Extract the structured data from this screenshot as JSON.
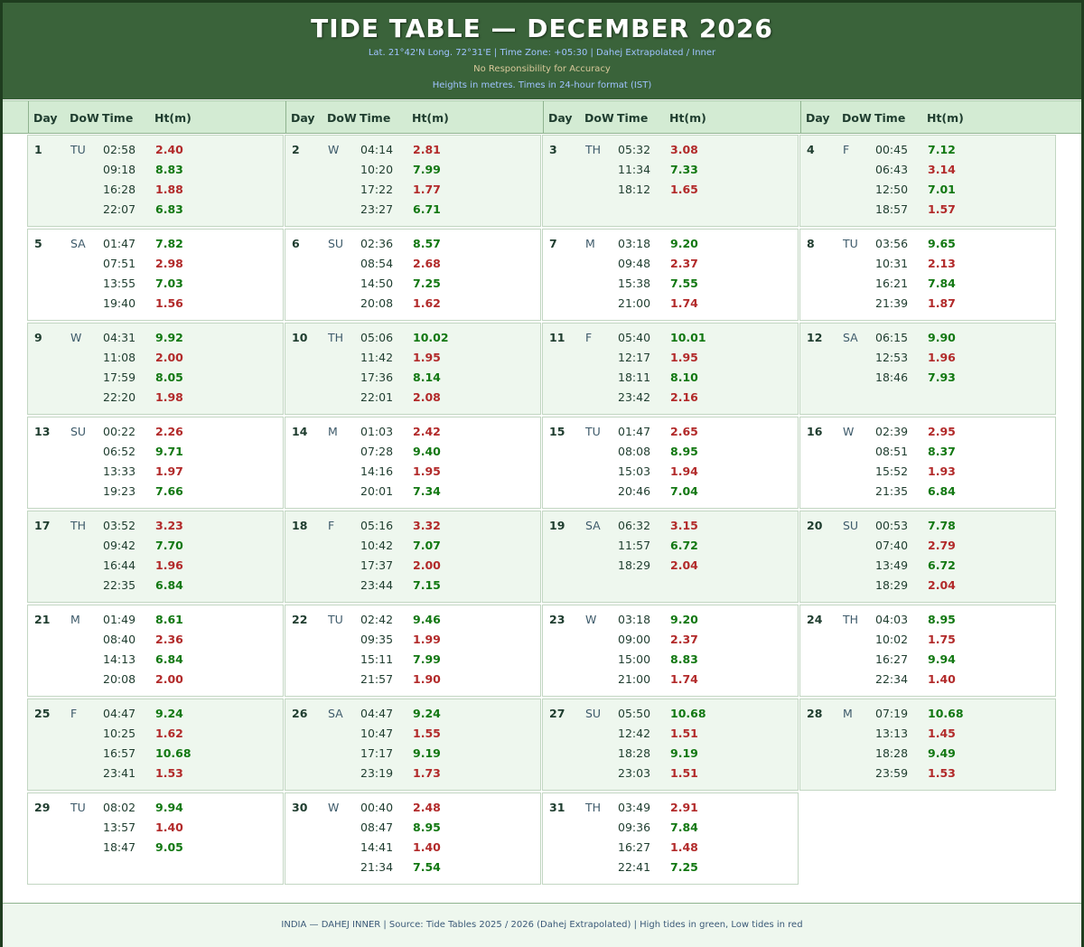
{
  "header": {
    "title": "TIDE TABLE — DECEMBER 2026",
    "line1": "Lat. 21°42'N  Long. 72°31'E   |   Time Zone: +05:30   |   Dahej Extrapolated / Inner",
    "line2": "No Responsibility for Accuracy",
    "line3": "Heights in metres.  Times in 24-hour format (IST)"
  },
  "columns": {
    "day": "Day",
    "dow": "DoW",
    "time": "Time",
    "height": "Ht(m)"
  },
  "days": [
    {
      "day": "1",
      "dow": "TU",
      "tides": [
        {
          "t": "02:58",
          "h": "2.40",
          "type": "low"
        },
        {
          "t": "09:18",
          "h": "8.83",
          "type": "high"
        },
        {
          "t": "16:28",
          "h": "1.88",
          "type": "low"
        },
        {
          "t": "22:07",
          "h": "6.83",
          "type": "high"
        }
      ]
    },
    {
      "day": "2",
      "dow": "W",
      "tides": [
        {
          "t": "04:14",
          "h": "2.81",
          "type": "low"
        },
        {
          "t": "10:20",
          "h": "7.99",
          "type": "high"
        },
        {
          "t": "17:22",
          "h": "1.77",
          "type": "low"
        },
        {
          "t": "23:27",
          "h": "6.71",
          "type": "high"
        }
      ]
    },
    {
      "day": "3",
      "dow": "TH",
      "tides": [
        {
          "t": "05:32",
          "h": "3.08",
          "type": "low"
        },
        {
          "t": "11:34",
          "h": "7.33",
          "type": "high"
        },
        {
          "t": "18:12",
          "h": "1.65",
          "type": "low"
        }
      ]
    },
    {
      "day": "4",
      "dow": "F",
      "tides": [
        {
          "t": "00:45",
          "h": "7.12",
          "type": "high"
        },
        {
          "t": "06:43",
          "h": "3.14",
          "type": "low"
        },
        {
          "t": "12:50",
          "h": "7.01",
          "type": "high"
        },
        {
          "t": "18:57",
          "h": "1.57",
          "type": "low"
        }
      ]
    },
    {
      "day": "5",
      "dow": "SA",
      "tides": [
        {
          "t": "01:47",
          "h": "7.82",
          "type": "high"
        },
        {
          "t": "07:51",
          "h": "2.98",
          "type": "low"
        },
        {
          "t": "13:55",
          "h": "7.03",
          "type": "high"
        },
        {
          "t": "19:40",
          "h": "1.56",
          "type": "low"
        }
      ]
    },
    {
      "day": "6",
      "dow": "SU",
      "tides": [
        {
          "t": "02:36",
          "h": "8.57",
          "type": "high"
        },
        {
          "t": "08:54",
          "h": "2.68",
          "type": "low"
        },
        {
          "t": "14:50",
          "h": "7.25",
          "type": "high"
        },
        {
          "t": "20:08",
          "h": "1.62",
          "type": "low"
        }
      ]
    },
    {
      "day": "7",
      "dow": "M",
      "tides": [
        {
          "t": "03:18",
          "h": "9.20",
          "type": "high"
        },
        {
          "t": "09:48",
          "h": "2.37",
          "type": "low"
        },
        {
          "t": "15:38",
          "h": "7.55",
          "type": "high"
        },
        {
          "t": "21:00",
          "h": "1.74",
          "type": "low"
        }
      ]
    },
    {
      "day": "8",
      "dow": "TU",
      "tides": [
        {
          "t": "03:56",
          "h": "9.65",
          "type": "high"
        },
        {
          "t": "10:31",
          "h": "2.13",
          "type": "low"
        },
        {
          "t": "16:21",
          "h": "7.84",
          "type": "high"
        },
        {
          "t": "21:39",
          "h": "1.87",
          "type": "low"
        }
      ]
    },
    {
      "day": "9",
      "dow": "W",
      "tides": [
        {
          "t": "04:31",
          "h": "9.92",
          "type": "high"
        },
        {
          "t": "11:08",
          "h": "2.00",
          "type": "low"
        },
        {
          "t": "17:59",
          "h": "8.05",
          "type": "high"
        },
        {
          "t": "22:20",
          "h": "1.98",
          "type": "low"
        }
      ]
    },
    {
      "day": "10",
      "dow": "TH",
      "tides": [
        {
          "t": "05:06",
          "h": "10.02",
          "type": "high"
        },
        {
          "t": "11:42",
          "h": "1.95",
          "type": "low"
        },
        {
          "t": "17:36",
          "h": "8.14",
          "type": "high"
        },
        {
          "t": "22:01",
          "h": "2.08",
          "type": "low"
        }
      ]
    },
    {
      "day": "11",
      "dow": "F",
      "tides": [
        {
          "t": "05:40",
          "h": "10.01",
          "type": "high"
        },
        {
          "t": "12:17",
          "h": "1.95",
          "type": "low"
        },
        {
          "t": "18:11",
          "h": "8.10",
          "type": "high"
        },
        {
          "t": "23:42",
          "h": "2.16",
          "type": "low"
        }
      ]
    },
    {
      "day": "12",
      "dow": "SA",
      "tides": [
        {
          "t": "06:15",
          "h": "9.90",
          "type": "high"
        },
        {
          "t": "12:53",
          "h": "1.96",
          "type": "low"
        },
        {
          "t": "18:46",
          "h": "7.93",
          "type": "high"
        }
      ]
    },
    {
      "day": "13",
      "dow": "SU",
      "tides": [
        {
          "t": "00:22",
          "h": "2.26",
          "type": "low"
        },
        {
          "t": "06:52",
          "h": "9.71",
          "type": "high"
        },
        {
          "t": "13:33",
          "h": "1.97",
          "type": "low"
        },
        {
          "t": "19:23",
          "h": "7.66",
          "type": "high"
        }
      ]
    },
    {
      "day": "14",
      "dow": "M",
      "tides": [
        {
          "t": "01:03",
          "h": "2.42",
          "type": "low"
        },
        {
          "t": "07:28",
          "h": "9.40",
          "type": "high"
        },
        {
          "t": "14:16",
          "h": "1.95",
          "type": "low"
        },
        {
          "t": "20:01",
          "h": "7.34",
          "type": "high"
        }
      ]
    },
    {
      "day": "15",
      "dow": "TU",
      "tides": [
        {
          "t": "01:47",
          "h": "2.65",
          "type": "low"
        },
        {
          "t": "08:08",
          "h": "8.95",
          "type": "high"
        },
        {
          "t": "15:03",
          "h": "1.94",
          "type": "low"
        },
        {
          "t": "20:46",
          "h": "7.04",
          "type": "high"
        }
      ]
    },
    {
      "day": "16",
      "dow": "W",
      "tides": [
        {
          "t": "02:39",
          "h": "2.95",
          "type": "low"
        },
        {
          "t": "08:51",
          "h": "8.37",
          "type": "high"
        },
        {
          "t": "15:52",
          "h": "1.93",
          "type": "low"
        },
        {
          "t": "21:35",
          "h": "6.84",
          "type": "high"
        }
      ]
    },
    {
      "day": "17",
      "dow": "TH",
      "tides": [
        {
          "t": "03:52",
          "h": "3.23",
          "type": "low"
        },
        {
          "t": "09:42",
          "h": "7.70",
          "type": "high"
        },
        {
          "t": "16:44",
          "h": "1.96",
          "type": "low"
        },
        {
          "t": "22:35",
          "h": "6.84",
          "type": "high"
        }
      ]
    },
    {
      "day": "18",
      "dow": "F",
      "tides": [
        {
          "t": "05:16",
          "h": "3.32",
          "type": "low"
        },
        {
          "t": "10:42",
          "h": "7.07",
          "type": "high"
        },
        {
          "t": "17:37",
          "h": "2.00",
          "type": "low"
        },
        {
          "t": "23:44",
          "h": "7.15",
          "type": "high"
        }
      ]
    },
    {
      "day": "19",
      "dow": "SA",
      "tides": [
        {
          "t": "06:32",
          "h": "3.15",
          "type": "low"
        },
        {
          "t": "11:57",
          "h": "6.72",
          "type": "high"
        },
        {
          "t": "18:29",
          "h": "2.04",
          "type": "low"
        }
      ]
    },
    {
      "day": "20",
      "dow": "SU",
      "tides": [
        {
          "t": "00:53",
          "h": "7.78",
          "type": "high"
        },
        {
          "t": "07:40",
          "h": "2.79",
          "type": "low"
        },
        {
          "t": "13:49",
          "h": "6.72",
          "type": "high"
        },
        {
          "t": "18:29",
          "h": "2.04",
          "type": "low"
        }
      ]
    },
    {
      "day": "21",
      "dow": "M",
      "tides": [
        {
          "t": "01:49",
          "h": "8.61",
          "type": "high"
        },
        {
          "t": "08:40",
          "h": "2.36",
          "type": "low"
        },
        {
          "t": "14:13",
          "h": "6.84",
          "type": "high"
        },
        {
          "t": "20:08",
          "h": "2.00",
          "type": "low"
        }
      ]
    },
    {
      "day": "22",
      "dow": "TU",
      "tides": [
        {
          "t": "02:42",
          "h": "9.46",
          "type": "high"
        },
        {
          "t": "09:35",
          "h": "1.99",
          "type": "low"
        },
        {
          "t": "15:11",
          "h": "7.99",
          "type": "high"
        },
        {
          "t": "21:57",
          "h": "1.90",
          "type": "low"
        }
      ]
    },
    {
      "day": "23",
      "dow": "W",
      "tides": [
        {
          "t": "03:18",
          "h": "9.20",
          "type": "high"
        },
        {
          "t": "09:00",
          "h": "2.37",
          "type": "low"
        },
        {
          "t": "15:00",
          "h": "8.83",
          "type": "high"
        },
        {
          "t": "21:00",
          "h": "1.74",
          "type": "low"
        }
      ]
    },
    {
      "day": "24",
      "dow": "TH",
      "tides": [
        {
          "t": "04:03",
          "h": "8.95",
          "type": "high"
        },
        {
          "t": "10:02",
          "h": "1.75",
          "type": "low"
        },
        {
          "t": "16:27",
          "h": "9.94",
          "type": "high"
        },
        {
          "t": "22:34",
          "h": "1.40",
          "type": "low"
        }
      ]
    },
    {
      "day": "25",
      "dow": "F",
      "tides": [
        {
          "t": "04:47",
          "h": "9.24",
          "type": "high"
        },
        {
          "t": "10:25",
          "h": "1.62",
          "type": "low"
        },
        {
          "t": "16:57",
          "h": "10.68",
          "type": "high"
        },
        {
          "t": "23:41",
          "h": "1.53",
          "type": "low"
        }
      ]
    },
    {
      "day": "26",
      "dow": "SA",
      "tides": [
        {
          "t": "04:47",
          "h": "9.24",
          "type": "high"
        },
        {
          "t": "10:47",
          "h": "1.55",
          "type": "low"
        },
        {
          "t": "17:17",
          "h": "9.19",
          "type": "high"
        },
        {
          "t": "23:19",
          "h": "1.73",
          "type": "low"
        }
      ]
    },
    {
      "day": "27",
      "dow": "SU",
      "tides": [
        {
          "t": "05:50",
          "h": "10.68",
          "type": "high"
        },
        {
          "t": "12:42",
          "h": "1.51",
          "type": "low"
        },
        {
          "t": "18:28",
          "h": "9.19",
          "type": "high"
        },
        {
          "t": "23:03",
          "h": "1.51",
          "type": "low"
        }
      ]
    },
    {
      "day": "28",
      "dow": "M",
      "tides": [
        {
          "t": "07:19",
          "h": "10.68",
          "type": "high"
        },
        {
          "t": "13:13",
          "h": "1.45",
          "type": "low"
        },
        {
          "t": "18:28",
          "h": "9.49",
          "type": "high"
        },
        {
          "t": "23:59",
          "h": "1.53",
          "type": "low"
        }
      ]
    },
    {
      "day": "29",
      "dow": "TU",
      "tides": [
        {
          "t": "08:02",
          "h": "9.94",
          "type": "high"
        },
        {
          "t": "13:57",
          "h": "1.40",
          "type": "low"
        },
        {
          "t": "18:47",
          "h": "9.05",
          "type": "high"
        }
      ]
    },
    {
      "day": "30",
      "dow": "W",
      "tides": [
        {
          "t": "00:40",
          "h": "2.48",
          "type": "low"
        },
        {
          "t": "08:47",
          "h": "8.95",
          "type": "high"
        },
        {
          "t": "14:41",
          "h": "1.40",
          "type": "low"
        },
        {
          "t": "21:34",
          "h": "7.54",
          "type": "high"
        }
      ]
    },
    {
      "day": "31",
      "dow": "TH",
      "tides": [
        {
          "t": "03:49",
          "h": "2.91",
          "type": "low"
        },
        {
          "t": "09:36",
          "h": "7.84",
          "type": "high"
        },
        {
          "t": "16:27",
          "h": "1.48",
          "type": "low"
        },
        {
          "t": "22:41",
          "h": "7.25",
          "type": "high"
        }
      ]
    }
  ],
  "footer": "INDIA — DAHEJ INNER   |   Source: Tide Tables 2025 / 2026 (Dahej Extrapolated)   |   High tides in green, Low tides in red",
  "colors": {
    "high": "#127812",
    "low": "#b22a2a",
    "header_bg": "#3a633a",
    "shade": "#eef7ee"
  }
}
